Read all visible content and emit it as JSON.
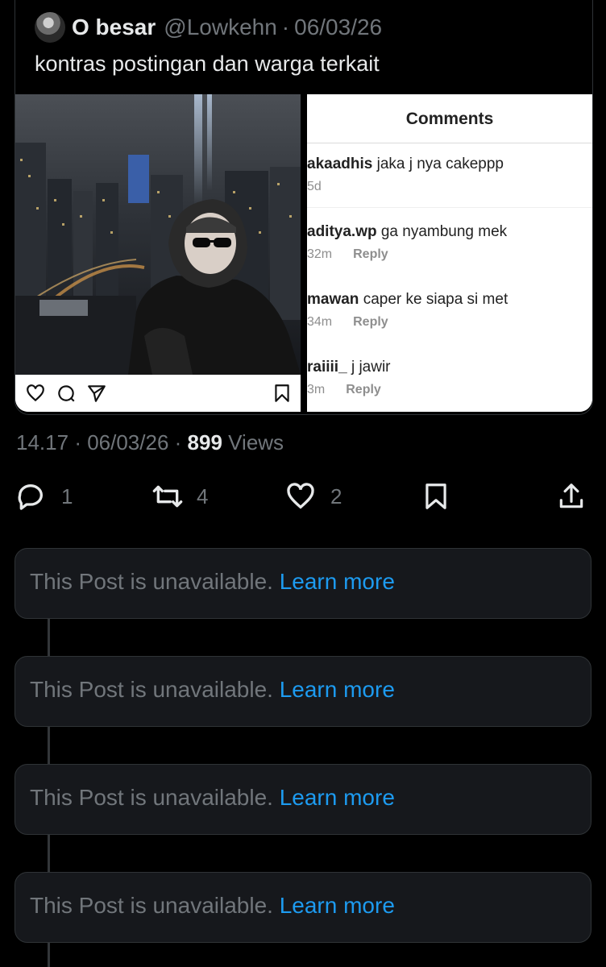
{
  "quote": {
    "display_name": "O besar",
    "handle": "@Lowkehn",
    "separator": "·",
    "date": "06/03/26",
    "text": "kontras postingan dan warga terkait",
    "comments_panel": {
      "title": "Comments",
      "items": [
        {
          "user": "akaadhis",
          "text": "jaka j nya cakeppp",
          "time": "5d",
          "reply": ""
        },
        {
          "user": "aditya.wp",
          "text": "ga nyambung mek",
          "time": "32m",
          "reply": "Reply"
        },
        {
          "user": "mawan",
          "text": "caper ke siapa si met",
          "time": "34m",
          "reply": "Reply"
        },
        {
          "user": "raiiii_",
          "text": "j jawir",
          "time": "3m",
          "reply": "Reply"
        }
      ]
    }
  },
  "post_meta": {
    "time": "14.17",
    "date": "06/03/26",
    "views_count": "899",
    "views_label": "Views"
  },
  "actions": {
    "replies": "1",
    "reposts": "4",
    "likes": "2"
  },
  "unavailable_posts": [
    {
      "text": "This Post is unavailable.",
      "link": "Learn more"
    },
    {
      "text": "This Post is unavailable.",
      "link": "Learn more"
    },
    {
      "text": "This Post is unavailable.",
      "link": "Learn more"
    },
    {
      "text": "This Post is unavailable.",
      "link": "Learn more"
    }
  ],
  "colors": {
    "background": "#000000",
    "muted_text": "#71767b",
    "link": "#1d9bf0",
    "card": "#16181c"
  }
}
